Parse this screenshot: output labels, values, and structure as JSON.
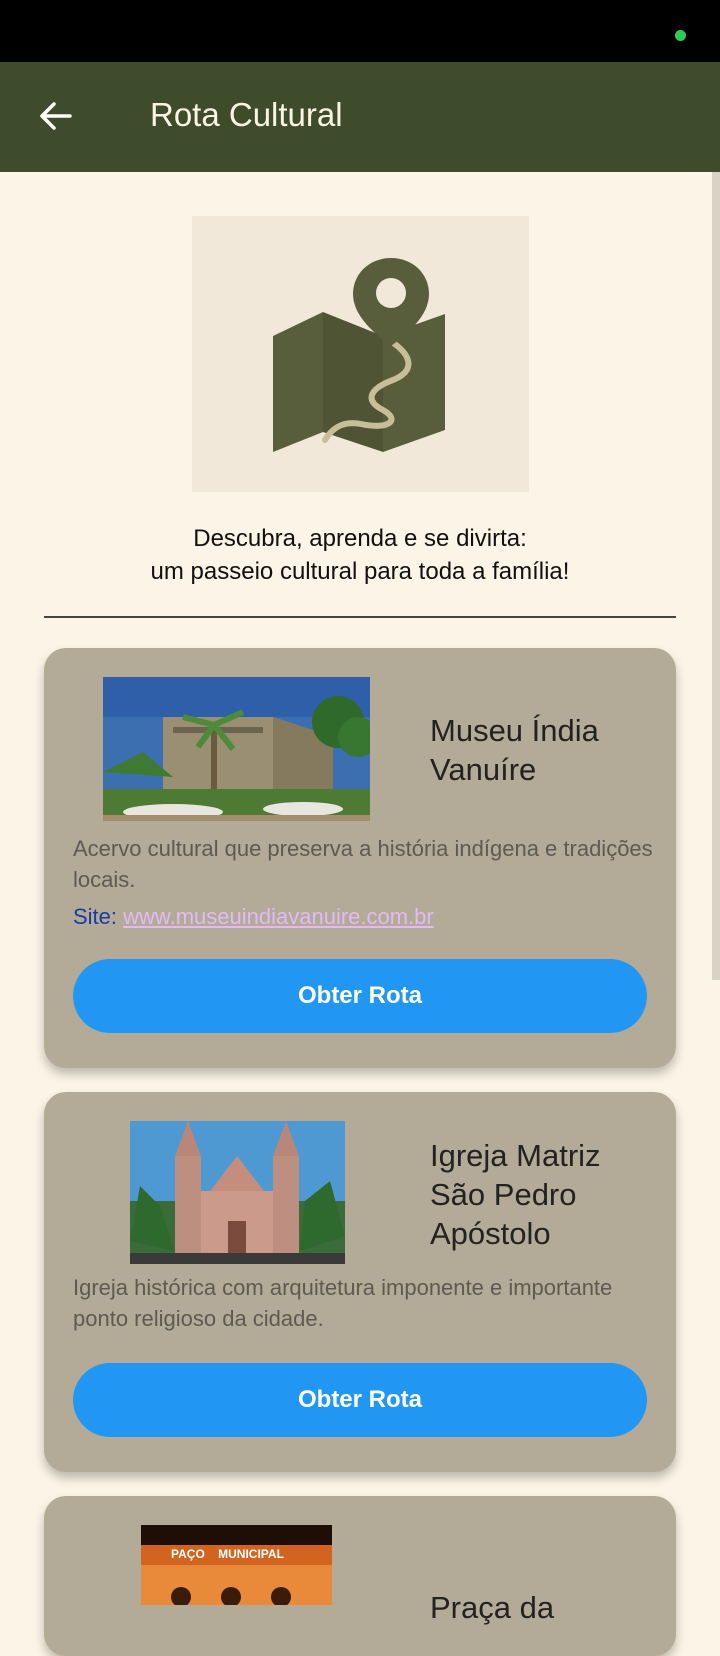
{
  "app_bar": {
    "title": "Rota Cultural",
    "back_icon": "arrow-left-icon"
  },
  "hero": {
    "icon": "map-pin-route-icon",
    "tagline_line1": "Descubra, aprenda e se divirta:",
    "tagline_line2": "um passeio cultural para toda a família!"
  },
  "places": [
    {
      "title_line1": "Museu Índia",
      "title_line2": "Vanuíre",
      "description": "Acervo cultural que preserva a história indígena e tradições locais.",
      "site_label": "Site:",
      "site_url": "www.museuindiavanuire.com.br",
      "button_label": "Obter Rota"
    },
    {
      "title_line1": "Igreja Matriz",
      "title_line2": "São Pedro",
      "title_line3": "Apóstolo",
      "description": "Igreja histórica com arquitetura imponente e importante ponto religioso da cidade.",
      "button_label": "Obter Rota"
    },
    {
      "title_line1": "Praça da",
      "image_text_1": "PAÇO",
      "image_text_2": "MUNICIPAL"
    }
  ],
  "colors": {
    "app_bar": "#3e4c2c",
    "background": "#fcf4e6",
    "card": "#b3ab98",
    "button": "#2296f3"
  }
}
